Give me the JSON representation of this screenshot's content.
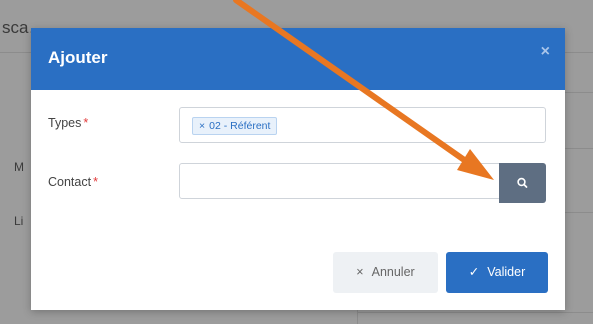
{
  "background": {
    "header_text": "sca…",
    "label_1": "M",
    "label_2": "Li"
  },
  "modal": {
    "title": "Ajouter",
    "close_glyph": "×",
    "fields": {
      "types": {
        "label": "Types",
        "required_mark": "*",
        "tags": [
          {
            "remove_glyph": "×",
            "label": "02 - Référent"
          }
        ]
      },
      "contact": {
        "label": "Contact",
        "required_mark": "*",
        "value": "",
        "placeholder": ""
      }
    },
    "search_button": {
      "icon": "search-icon"
    },
    "buttons": {
      "cancel": {
        "glyph": "×",
        "label": "Annuler"
      },
      "validate": {
        "glyph": "✓",
        "label": "Valider"
      }
    }
  },
  "colors": {
    "header_blue": "#2a6fc3",
    "search_button": "#5e6e82",
    "annotation_arrow": "#e87722",
    "required": "#e23b3b"
  }
}
